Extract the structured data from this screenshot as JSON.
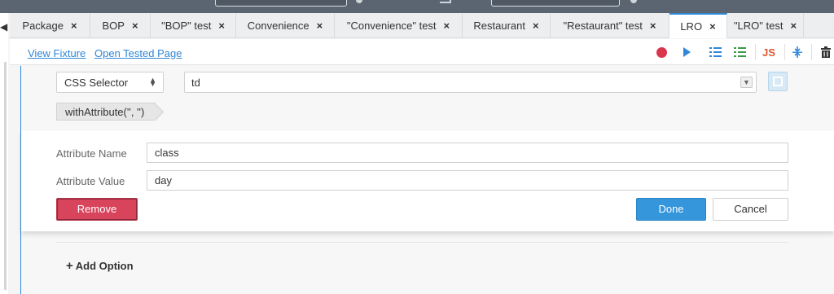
{
  "tabs": [
    {
      "label": "Package",
      "active": false
    },
    {
      "label": "BOP",
      "active": false
    },
    {
      "label": "\"BOP\" test",
      "active": false
    },
    {
      "label": "Convenience",
      "active": false
    },
    {
      "label": "\"Convenience\" test",
      "active": false
    },
    {
      "label": "Restaurant",
      "active": false
    },
    {
      "label": "\"Restaurant\" test",
      "active": false
    },
    {
      "label": "LRO",
      "active": true
    },
    {
      "label": "\"LRO\" test",
      "active": false
    }
  ],
  "tab_close_glyph": "×",
  "toolbar": {
    "view_fixture": "View Fixture",
    "open_tested_page": "Open Tested Page",
    "js_label": "JS",
    "icons": [
      "record-icon",
      "play-icon",
      "list-indent-icon",
      "list-check-icon",
      "js-icon",
      "collapse-icon",
      "trash-icon"
    ],
    "record_color": "#d9354d",
    "accent_color": "#2f87d8",
    "js_color": "#e4572e"
  },
  "selector": {
    "type": "CSS Selector",
    "value": "td"
  },
  "filter_chip": "withAttribute('', '')",
  "editor": {
    "attribute_name_label": "Attribute Name",
    "attribute_name_value": "class",
    "attribute_value_label": "Attribute Value",
    "attribute_value_value": "day",
    "remove_label": "Remove",
    "done_label": "Done",
    "cancel_label": "Cancel"
  },
  "add_option": {
    "plus": "+",
    "label": "Add Option"
  }
}
